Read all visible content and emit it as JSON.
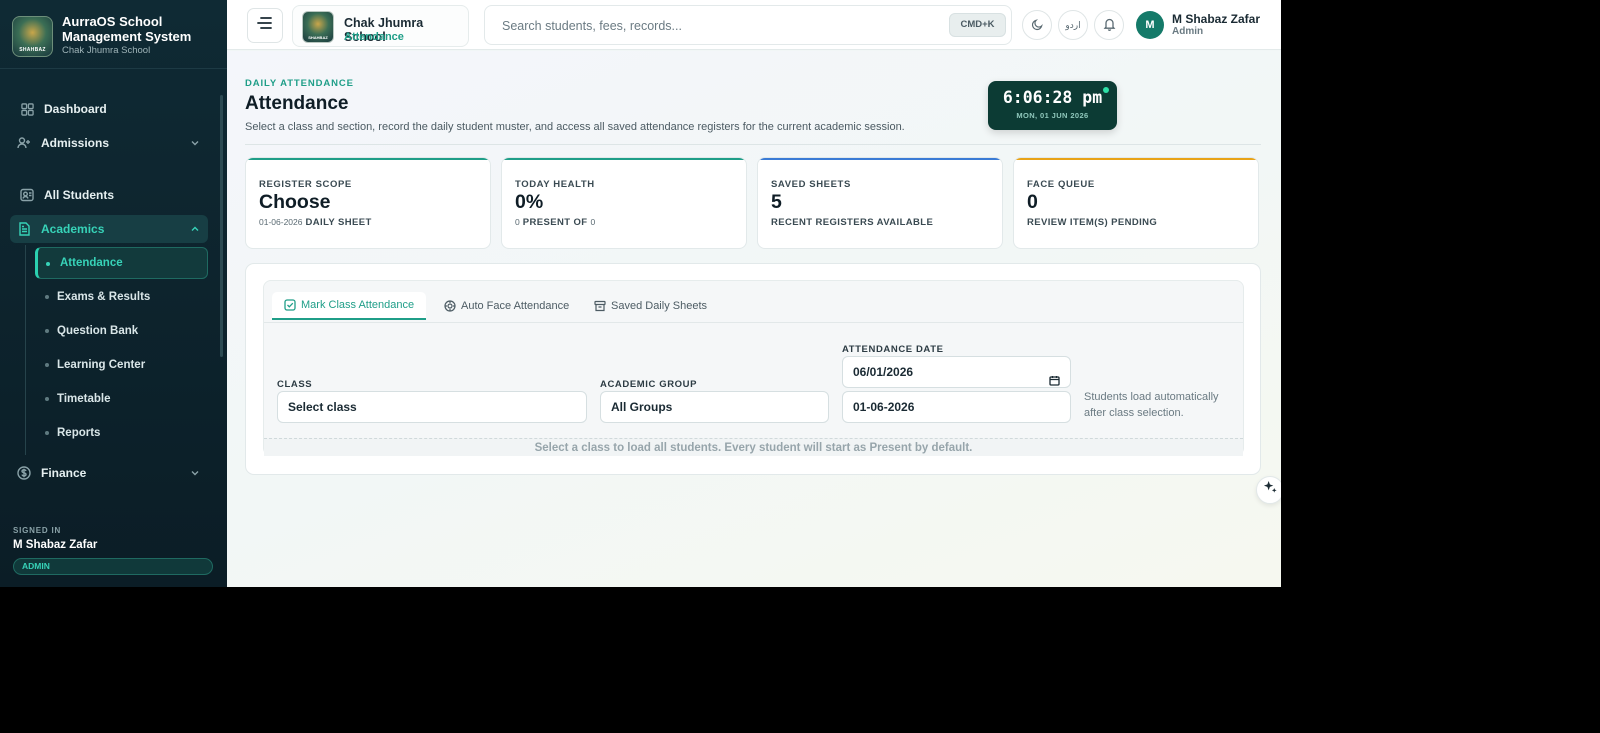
{
  "sidebar": {
    "brand_title": "AurraOS School Management System",
    "brand_sub": "Chak Jhumra School",
    "logo_caption": "SHAHBAZ",
    "nav": {
      "dashboard": "Dashboard",
      "admissions": "Admissions",
      "all_students": "All Students",
      "academics": "Academics",
      "finance": "Finance"
    },
    "academics_sub": {
      "attendance": "Attendance",
      "exams": "Exams & Results",
      "question_bank": "Question Bank",
      "learning_center": "Learning Center",
      "timetable": "Timetable",
      "reports": "Reports"
    },
    "signed_in_label": "SIGNED IN",
    "signed_in_name": "M Shabaz Zafar",
    "role": "ADMIN"
  },
  "topbar": {
    "school_name": "Chak Jhumra School",
    "school_sub": "Attendance",
    "search_placeholder": "Search students, fees, records...",
    "shortcut": "CMD+K",
    "lang": "اردو",
    "avatar_initial": "M",
    "user_name": "M Shabaz Zafar",
    "user_role": "Admin"
  },
  "header": {
    "eyebrow": "DAILY ATTENDANCE",
    "title": "Attendance",
    "description": "Select a class and section, record the daily student muster, and access all saved attendance registers for the current academic session.",
    "clock_time": "6:06:28 pm",
    "clock_date": "MON, 01 JUN 2026"
  },
  "stats": {
    "scope": {
      "label": "REGISTER SCOPE",
      "value": "Choose",
      "foot_small": "01-06-2026",
      "foot": "DAILY SHEET"
    },
    "health": {
      "label": "TODAY HEALTH",
      "value": "0%",
      "foot_small1": "0",
      "foot": "PRESENT OF",
      "foot_small2": "0"
    },
    "saved": {
      "label": "SAVED SHEETS",
      "value": "5",
      "foot": "RECENT REGISTERS AVAILABLE"
    },
    "face": {
      "label": "FACE QUEUE",
      "value": "0",
      "foot": "REVIEW ITEM(S) PENDING"
    }
  },
  "tabs": {
    "mark": "Mark Class Attendance",
    "face": "Auto Face Attendance",
    "saved": "Saved Daily Sheets"
  },
  "form": {
    "class_label": "CLASS",
    "class_value": "Select class",
    "group_label": "ACADEMIC GROUP",
    "group_value": "All Groups",
    "date_label": "ATTENDANCE DATE",
    "date_input": "06/01/2026",
    "date_display": "01-06-2026",
    "hint": "Students load automatically after class selection.",
    "notice": "Select a class to load all students. Every student will start as Present by default."
  },
  "colors": {
    "accent": "#1f9e88",
    "sidebar_bg": "#0f2a34",
    "stat_bar_teal": "#1f9e88",
    "stat_bar_blue": "#3a7bd5",
    "stat_bar_amber": "#e8a317"
  }
}
